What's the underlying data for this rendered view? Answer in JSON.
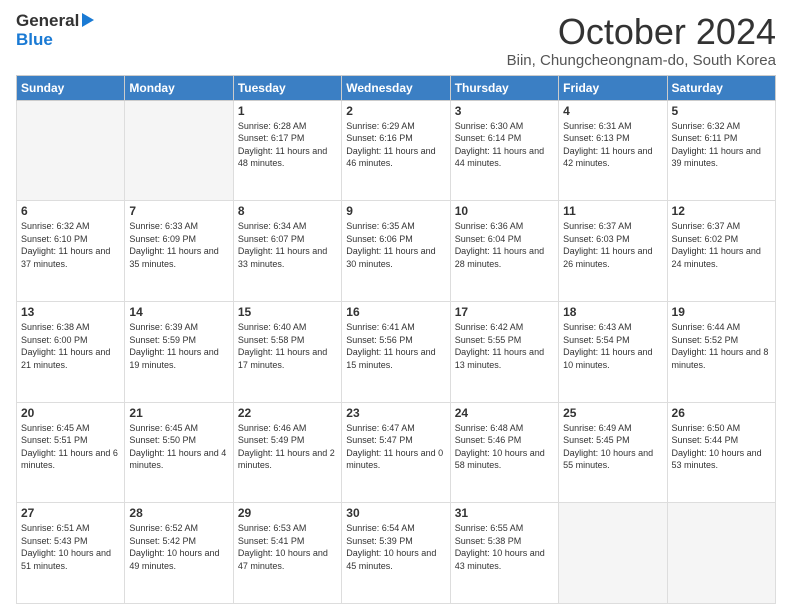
{
  "logo": {
    "line1": "General",
    "line2": "Blue"
  },
  "title": "October 2024",
  "location": "Biin, Chungcheongnam-do, South Korea",
  "days_of_week": [
    "Sunday",
    "Monday",
    "Tuesday",
    "Wednesday",
    "Thursday",
    "Friday",
    "Saturday"
  ],
  "weeks": [
    [
      {
        "day": "",
        "info": ""
      },
      {
        "day": "",
        "info": ""
      },
      {
        "day": "1",
        "sunrise": "6:28 AM",
        "sunset": "6:17 PM",
        "daylight": "11 hours and 48 minutes."
      },
      {
        "day": "2",
        "sunrise": "6:29 AM",
        "sunset": "6:16 PM",
        "daylight": "11 hours and 46 minutes."
      },
      {
        "day": "3",
        "sunrise": "6:30 AM",
        "sunset": "6:14 PM",
        "daylight": "11 hours and 44 minutes."
      },
      {
        "day": "4",
        "sunrise": "6:31 AM",
        "sunset": "6:13 PM",
        "daylight": "11 hours and 42 minutes."
      },
      {
        "day": "5",
        "sunrise": "6:32 AM",
        "sunset": "6:11 PM",
        "daylight": "11 hours and 39 minutes."
      }
    ],
    [
      {
        "day": "6",
        "sunrise": "6:32 AM",
        "sunset": "6:10 PM",
        "daylight": "11 hours and 37 minutes."
      },
      {
        "day": "7",
        "sunrise": "6:33 AM",
        "sunset": "6:09 PM",
        "daylight": "11 hours and 35 minutes."
      },
      {
        "day": "8",
        "sunrise": "6:34 AM",
        "sunset": "6:07 PM",
        "daylight": "11 hours and 33 minutes."
      },
      {
        "day": "9",
        "sunrise": "6:35 AM",
        "sunset": "6:06 PM",
        "daylight": "11 hours and 30 minutes."
      },
      {
        "day": "10",
        "sunrise": "6:36 AM",
        "sunset": "6:04 PM",
        "daylight": "11 hours and 28 minutes."
      },
      {
        "day": "11",
        "sunrise": "6:37 AM",
        "sunset": "6:03 PM",
        "daylight": "11 hours and 26 minutes."
      },
      {
        "day": "12",
        "sunrise": "6:37 AM",
        "sunset": "6:02 PM",
        "daylight": "11 hours and 24 minutes."
      }
    ],
    [
      {
        "day": "13",
        "sunrise": "6:38 AM",
        "sunset": "6:00 PM",
        "daylight": "11 hours and 21 minutes."
      },
      {
        "day": "14",
        "sunrise": "6:39 AM",
        "sunset": "5:59 PM",
        "daylight": "11 hours and 19 minutes."
      },
      {
        "day": "15",
        "sunrise": "6:40 AM",
        "sunset": "5:58 PM",
        "daylight": "11 hours and 17 minutes."
      },
      {
        "day": "16",
        "sunrise": "6:41 AM",
        "sunset": "5:56 PM",
        "daylight": "11 hours and 15 minutes."
      },
      {
        "day": "17",
        "sunrise": "6:42 AM",
        "sunset": "5:55 PM",
        "daylight": "11 hours and 13 minutes."
      },
      {
        "day": "18",
        "sunrise": "6:43 AM",
        "sunset": "5:54 PM",
        "daylight": "11 hours and 10 minutes."
      },
      {
        "day": "19",
        "sunrise": "6:44 AM",
        "sunset": "5:52 PM",
        "daylight": "11 hours and 8 minutes."
      }
    ],
    [
      {
        "day": "20",
        "sunrise": "6:45 AM",
        "sunset": "5:51 PM",
        "daylight": "11 hours and 6 minutes."
      },
      {
        "day": "21",
        "sunrise": "6:45 AM",
        "sunset": "5:50 PM",
        "daylight": "11 hours and 4 minutes."
      },
      {
        "day": "22",
        "sunrise": "6:46 AM",
        "sunset": "5:49 PM",
        "daylight": "11 hours and 2 minutes."
      },
      {
        "day": "23",
        "sunrise": "6:47 AM",
        "sunset": "5:47 PM",
        "daylight": "11 hours and 0 minutes."
      },
      {
        "day": "24",
        "sunrise": "6:48 AM",
        "sunset": "5:46 PM",
        "daylight": "10 hours and 58 minutes."
      },
      {
        "day": "25",
        "sunrise": "6:49 AM",
        "sunset": "5:45 PM",
        "daylight": "10 hours and 55 minutes."
      },
      {
        "day": "26",
        "sunrise": "6:50 AM",
        "sunset": "5:44 PM",
        "daylight": "10 hours and 53 minutes."
      }
    ],
    [
      {
        "day": "27",
        "sunrise": "6:51 AM",
        "sunset": "5:43 PM",
        "daylight": "10 hours and 51 minutes."
      },
      {
        "day": "28",
        "sunrise": "6:52 AM",
        "sunset": "5:42 PM",
        "daylight": "10 hours and 49 minutes."
      },
      {
        "day": "29",
        "sunrise": "6:53 AM",
        "sunset": "5:41 PM",
        "daylight": "10 hours and 47 minutes."
      },
      {
        "day": "30",
        "sunrise": "6:54 AM",
        "sunset": "5:39 PM",
        "daylight": "10 hours and 45 minutes."
      },
      {
        "day": "31",
        "sunrise": "6:55 AM",
        "sunset": "5:38 PM",
        "daylight": "10 hours and 43 minutes."
      },
      {
        "day": "",
        "info": ""
      },
      {
        "day": "",
        "info": ""
      }
    ]
  ]
}
